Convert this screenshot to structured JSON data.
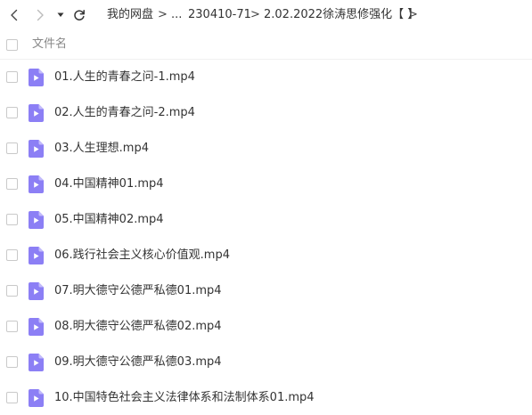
{
  "toolbar": {
    "breadcrumbs": [
      "我的网盘",
      "...",
      "230410-71",
      "2.02.2022徐涛思修强化【 】"
    ],
    "separator": ">",
    "trailing_chevron": ">"
  },
  "list_header": {
    "column_name": "文件名"
  },
  "files": [
    {
      "name": "01.人生的青春之问-1.mp4"
    },
    {
      "name": "02.人生的青春之问-2.mp4"
    },
    {
      "name": "03.人生理想.mp4"
    },
    {
      "name": "04.中国精神01.mp4"
    },
    {
      "name": "05.中国精神02.mp4"
    },
    {
      "name": "06.践行社会主义核心价值观.mp4"
    },
    {
      "name": "07.明大德守公德严私德01.mp4"
    },
    {
      "name": "08.明大德守公德严私德02.mp4"
    },
    {
      "name": "09.明大德守公德严私德03.mp4"
    },
    {
      "name": "10.中国特色社会主义法律体系和法制体系01.mp4"
    }
  ],
  "colors": {
    "video_icon": "#8c7ff5",
    "video_icon_fold": "#c3bbfb",
    "text": "#333333",
    "muted_text": "#888888"
  },
  "icons": {
    "back": "chevron-left-icon",
    "forward": "chevron-right-icon",
    "dropdown": "caret-down-icon",
    "refresh": "refresh-icon",
    "file": "video-file-icon"
  }
}
